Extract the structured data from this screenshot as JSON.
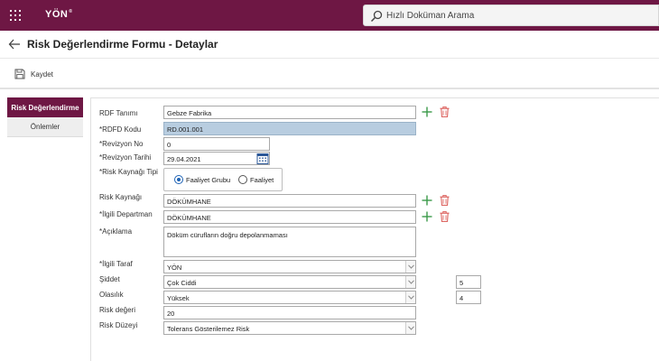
{
  "header": {
    "logo_text": "YÖN",
    "logo_mark": "®",
    "search_placeholder": "Hızlı Doküman Arama"
  },
  "page": {
    "title": "Risk Değerlendirme Formu - Detaylar"
  },
  "toolbar": {
    "save_label": "Kaydet"
  },
  "side_tabs": [
    {
      "label": "Risk Değerlendirme",
      "active": true
    },
    {
      "label": "Önlemler",
      "active": false
    }
  ],
  "form": {
    "rdf_tanimi": {
      "label": "RDF Tanımı",
      "value": "Gebze Fabrika"
    },
    "rdfd_kodu": {
      "label": "*RDFD Kodu",
      "value": "RD.001.001"
    },
    "revizyon_no": {
      "label": "*Revizyon No",
      "value": "0"
    },
    "revizyon_tarihi": {
      "label": "*Revizyon Tarihi",
      "value": "29.04.2021"
    },
    "risk_kaynagi_tipi": {
      "label": "*Risk Kaynağı Tipi",
      "options": [
        "Faaliyet Grubu",
        "Faaliyet"
      ],
      "selected": "Faaliyet Grubu"
    },
    "risk_kaynagi": {
      "label": "Risk Kaynağı",
      "value": "DÖKÜMHANE"
    },
    "ilgili_departman": {
      "label": "*İlgili Departman",
      "value": "DÖKÜMHANE"
    },
    "aciklama": {
      "label": "*Açıklama",
      "value": "Döküm cürufların doğru depolanmaması"
    },
    "ilgili_taraf": {
      "label": "*İlgili Taraf",
      "value": "YÖN"
    },
    "siddet": {
      "label": "Şiddet",
      "value": "Çok Ciddi",
      "score": "5"
    },
    "olasilik": {
      "label": "Olasılık",
      "value": "Yüksek",
      "score": "4"
    },
    "risk_degeri": {
      "label": "Risk değeri",
      "value": "20"
    },
    "risk_duzeyi": {
      "label": "Risk Düzeyi",
      "value": "Tolerans Gösterilemez Risk"
    }
  },
  "colors": {
    "brand": "#6e1744",
    "add_green": "#3a9a4a",
    "delete_red": "#d9534f",
    "highlight_blue": "#b8cde0"
  }
}
